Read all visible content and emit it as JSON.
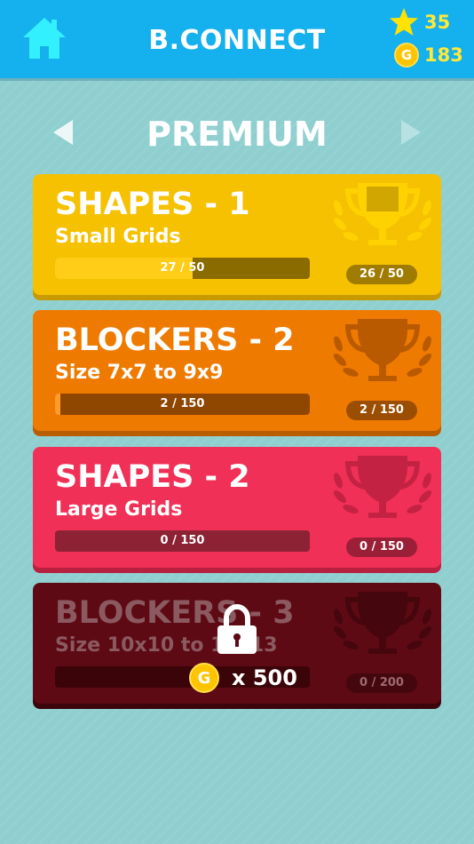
{
  "header": {
    "title": "B.CONNECT",
    "stars": "35",
    "coins": "183",
    "coin_letter": "G"
  },
  "nav": {
    "section": "PREMIUM"
  },
  "packs": [
    {
      "name": "SHAPES - 1",
      "subtitle": "Small Grids",
      "progress_text": "27 / 50",
      "progress": 0.54,
      "trophy_text": "26 / 50",
      "color": "#f6c100",
      "trophy_color": "#ffd400"
    },
    {
      "name": "BLOCKERS - 2",
      "subtitle": "Size 7x7 to 9x9",
      "progress_text": "2 / 150",
      "progress": 0.013,
      "trophy_text": "2 / 150",
      "color": "#ef7a00"
    },
    {
      "name": "SHAPES - 2",
      "subtitle": "Large Grids",
      "progress_text": "0 / 150",
      "progress": 0.0,
      "trophy_text": "0 / 150",
      "color": "#f03056"
    },
    {
      "name": "BLOCKERS - 3",
      "subtitle": "Size 10x10 to 13x13",
      "locked": true,
      "unlock_price": "x 500",
      "trophy_text": "0 / 200",
      "color": "#5e0a14"
    }
  ]
}
